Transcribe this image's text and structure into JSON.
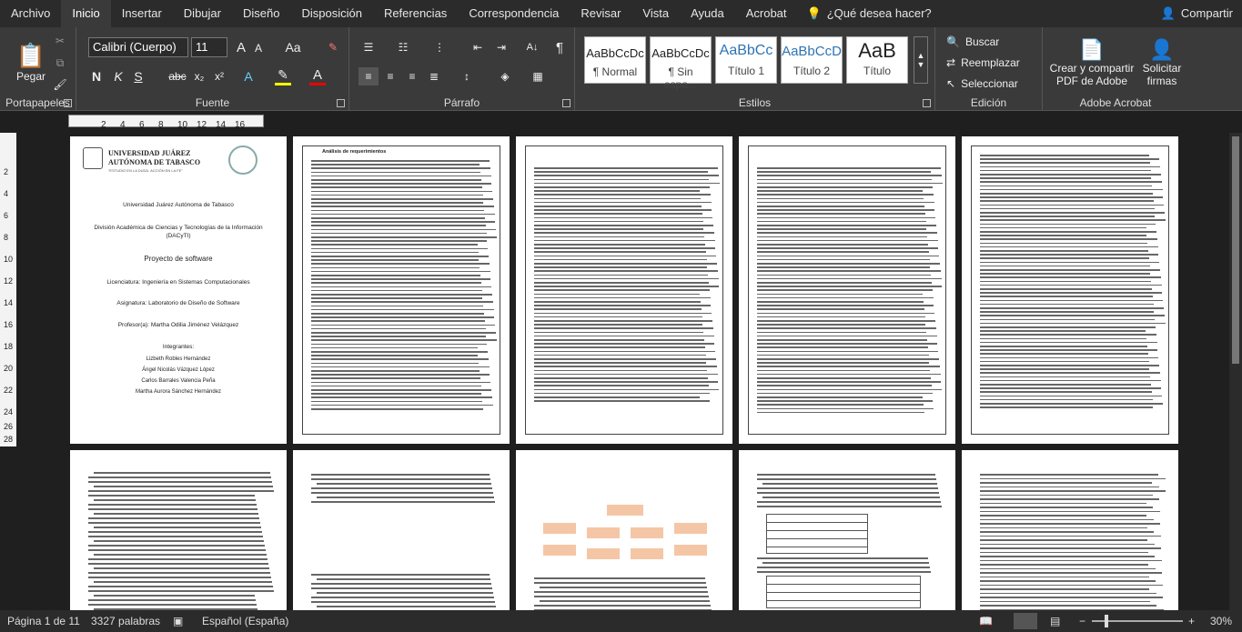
{
  "tabs": [
    "Archivo",
    "Inicio",
    "Insertar",
    "Dibujar",
    "Diseño",
    "Disposición",
    "Referencias",
    "Correspondencia",
    "Revisar",
    "Vista",
    "Ayuda",
    "Acrobat"
  ],
  "tell_me": "¿Qué desea hacer?",
  "share": "Compartir",
  "ribbon": {
    "clipboard": {
      "paste": "Pegar",
      "label": "Portapapeles"
    },
    "font": {
      "name": "Calibri (Cuerpo)",
      "size": "11",
      "label": "Fuente"
    },
    "paragraph": {
      "label": "Párrafo"
    },
    "styles": {
      "label": "Estilos",
      "items": [
        {
          "sample": "AaBbCcDc",
          "name": "¶ Normal"
        },
        {
          "sample": "AaBbCcDc",
          "name": "¶ Sin espa..."
        },
        {
          "sample": "AaBbCc",
          "name": "Título 1"
        },
        {
          "sample": "AaBbCcD",
          "name": "Título 2"
        },
        {
          "sample": "AaB",
          "name": "Título"
        }
      ]
    },
    "editing": {
      "search": "Buscar",
      "replace": "Reemplazar",
      "select": "Seleccionar",
      "label": "Edición"
    },
    "acrobat": {
      "create": "Crear y compartir PDF de Adobe",
      "sign": "Solicitar firmas",
      "label": "Adobe Acrobat"
    }
  },
  "ruler": {
    "hnums": [
      "2",
      "4",
      "6",
      "8",
      "10",
      "12",
      "14",
      "16"
    ],
    "vnums": [
      "2",
      "4",
      "6",
      "8",
      "10",
      "12",
      "14",
      "16",
      "18",
      "20",
      "22",
      "24",
      "26",
      "28"
    ]
  },
  "page1": {
    "uni1": "UNIVERSIDAD JUÁREZ",
    "uni2": "AUTÓNOMA DE TABASCO",
    "motto": "\"ESTUDIO EN LA DUDA. ACCIÓN EN LA FE\"",
    "l1": "Universidad Juárez Autónoma de Tabasco",
    "l2": "División Académica de Ciencias y Tecnologías de la Información (DACyTI)",
    "l3": "Proyecto de software",
    "l4": "Licenciatura: Ingeniería en Sistemas Computacionales",
    "l5": "Asignatura: Laboratorio de Diseño de Software",
    "l6": "Profesor(a): Martha Odilia Jiménez Velázquez",
    "l7": "Integrantes:",
    "n1": "Lizbeth Robles Hernández",
    "n2": "Ángel Nicolás Vázquez López",
    "n3": "Carlos Barrales Valencia Peña",
    "n4": "Martha Aurora Sánchez Hernández"
  },
  "page2_title": "Análisis de requerimientos",
  "status": {
    "page": "Página 1 de 11",
    "words": "3327 palabras",
    "lang": "Español (España)",
    "zoom": "30%"
  }
}
